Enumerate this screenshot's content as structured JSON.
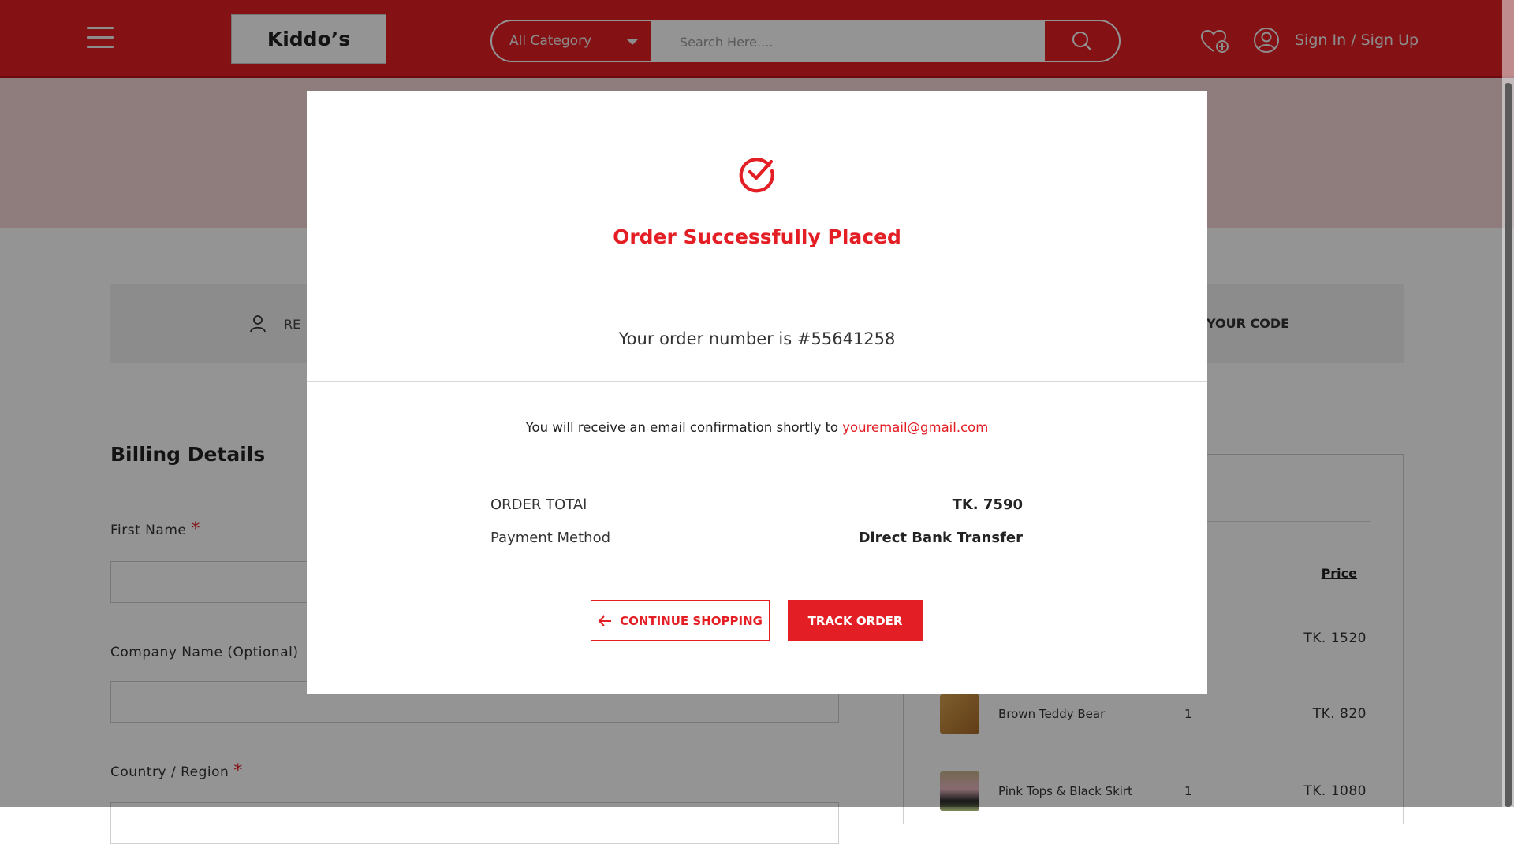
{
  "header": {
    "logo": "Kiddo’s",
    "category_select": "All Category",
    "search_placeholder": "Search Here....",
    "auth_link": "Sign In / Sign Up"
  },
  "page": {
    "coupon_bar": {
      "left_text": "RE",
      "right_text": "YOUR CODE"
    },
    "billing": {
      "title": "Billing Details",
      "fields": [
        {
          "label": "First Name",
          "required": "*"
        },
        {
          "label": "Company Name (Optional)",
          "required": ""
        },
        {
          "label": "Country / Region",
          "required": "*"
        }
      ]
    },
    "order_summary": {
      "price_header": "Price",
      "items": [
        {
          "name": "",
          "qty": "",
          "price": "TK. 1520"
        },
        {
          "name": "Brown Teddy Bear",
          "qty": "1",
          "price": "TK. 820"
        },
        {
          "name": "Pink Tops & Black Skirt",
          "qty": "1",
          "price": "TK. 1080"
        }
      ]
    }
  },
  "modal": {
    "title": "Order Successfully Placed",
    "order_number_text": "Your order number is #55641258",
    "email_text": "You will receive an email confirmation shortly to",
    "email": "youremail@gmail.com",
    "summary": [
      {
        "label": "ORDER TOTAl",
        "value": "TK. 7590"
      },
      {
        "label": "Payment Method",
        "value": "Direct Bank Transfer"
      }
    ],
    "continue_button": "CONTINUE SHOPPING",
    "track_button": "TRACK ORDER"
  },
  "colors": {
    "brand_red": "#e31e24",
    "overlay": "rgba(0,0,0,0.42)"
  },
  "icons": [
    "hamburger-icon",
    "chevron-down-icon",
    "search-icon",
    "wishlist-heart-icon",
    "user-icon",
    "check-circle-icon",
    "arrow-left-icon"
  ]
}
